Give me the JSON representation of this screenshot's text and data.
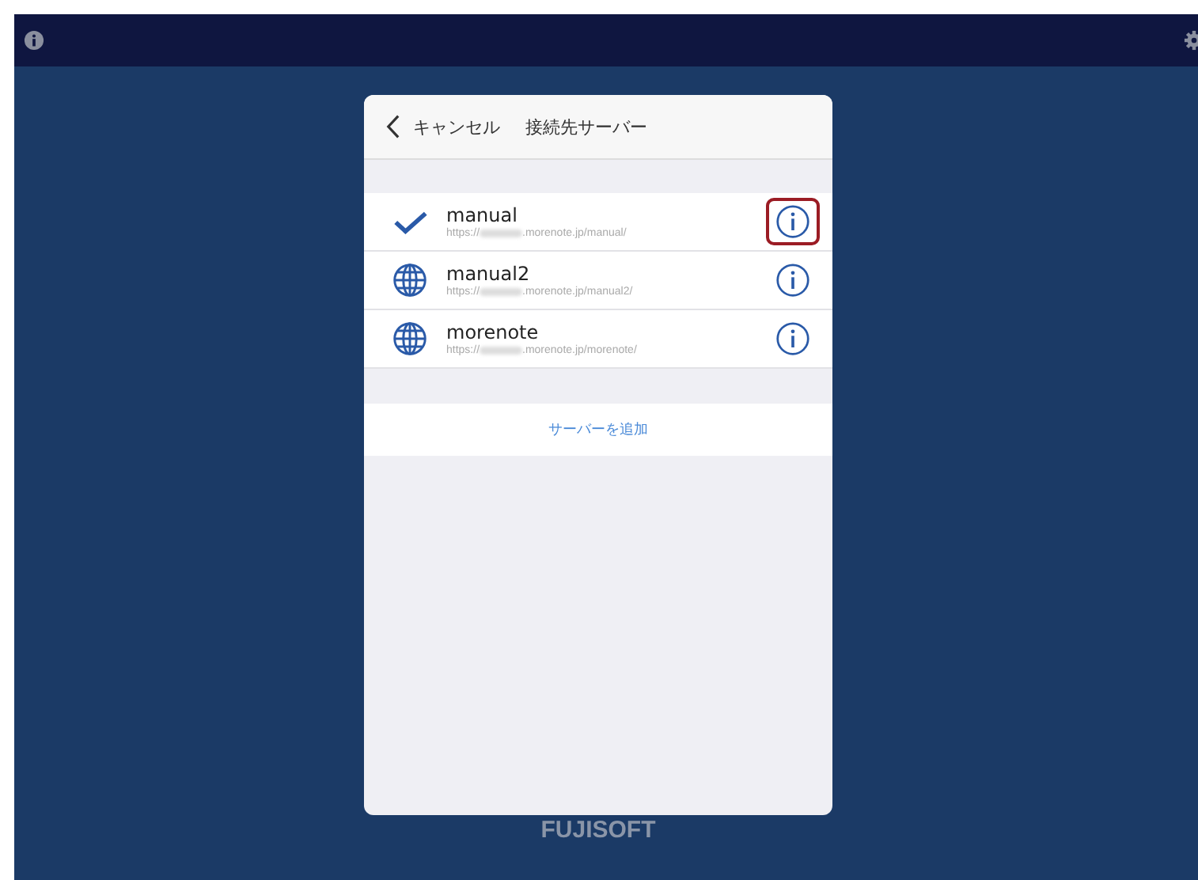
{
  "dialog": {
    "back_label": "キャンセル",
    "title": "接続先サーバー",
    "servers": [
      {
        "name": "manual",
        "url_prefix": "https://",
        "url_suffix": ".morenote.jp/manual/",
        "selected": true,
        "highlighted": true
      },
      {
        "name": "manual2",
        "url_prefix": "https://",
        "url_suffix": ".morenote.jp/manual2/",
        "selected": false,
        "highlighted": false
      },
      {
        "name": "morenote",
        "url_prefix": "https://",
        "url_suffix": ".morenote.jp/morenote/",
        "selected": false,
        "highlighted": false
      }
    ],
    "add_button": "サーバーを追加"
  },
  "footer_logo": "FUJISOFT"
}
